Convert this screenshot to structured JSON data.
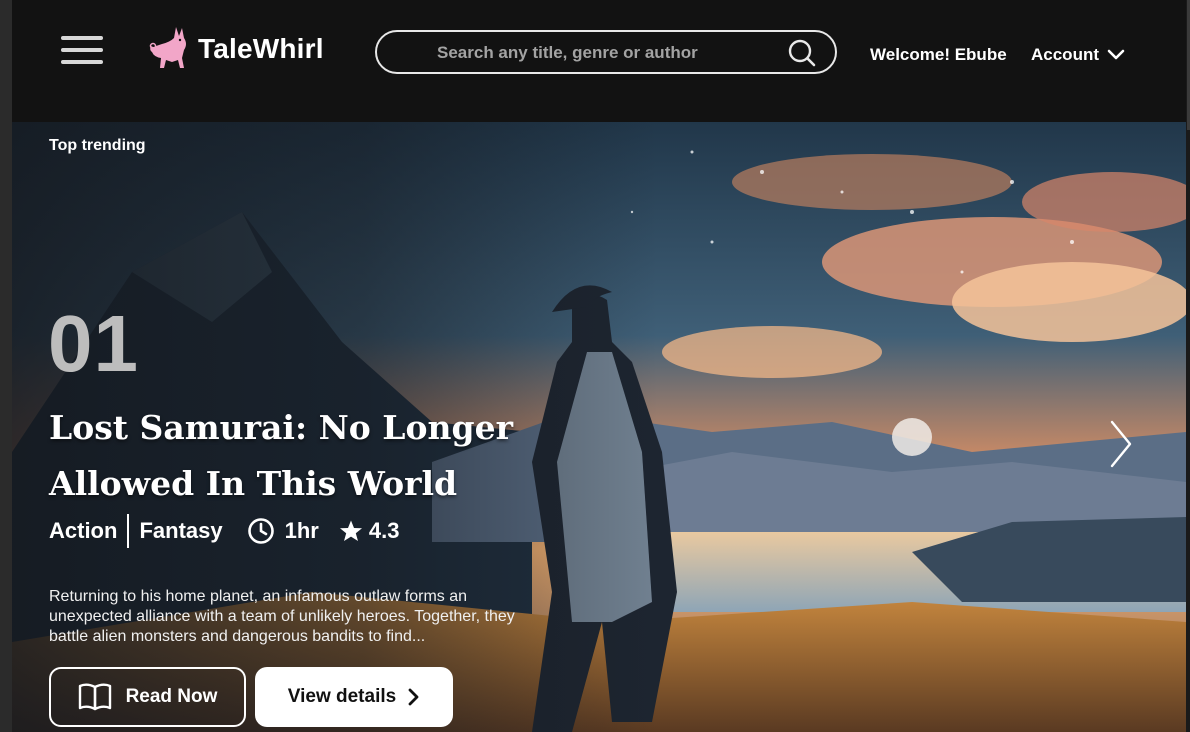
{
  "header": {
    "brand": "TaleWhirl",
    "search_placeholder": "Search any title, genre or author",
    "welcome": "Welcome! Ebube",
    "account": "Account"
  },
  "hero": {
    "section_label": "Top trending",
    "rank": "01",
    "title_line1": "Lost Samurai:  No Longer",
    "title_line2": "Allowed In This World",
    "genres": [
      "Action",
      "Fantasy"
    ],
    "duration": "1hr",
    "rating": "4.3",
    "description": "Returning to his home planet, an infamous outlaw forms an unexpected alliance with a team of unlikely heroes. Together, they battle alien monsters and dangerous bandits to find...",
    "read_label": "Read Now",
    "details_label": "View details"
  },
  "icons": {
    "menu": "hamburger-menu-icon",
    "logo": "cat-logo-icon",
    "search": "search-icon",
    "account": "chevron-down-icon",
    "clock": "clock-icon",
    "star": "star-icon",
    "book": "book-open-icon",
    "details": "chevron-right-icon",
    "next": "chevron-right-icon"
  },
  "colors": {
    "header_bg": "#121212",
    "logo_accent": "#f2a6c8",
    "button_bg": "#ffffff"
  }
}
